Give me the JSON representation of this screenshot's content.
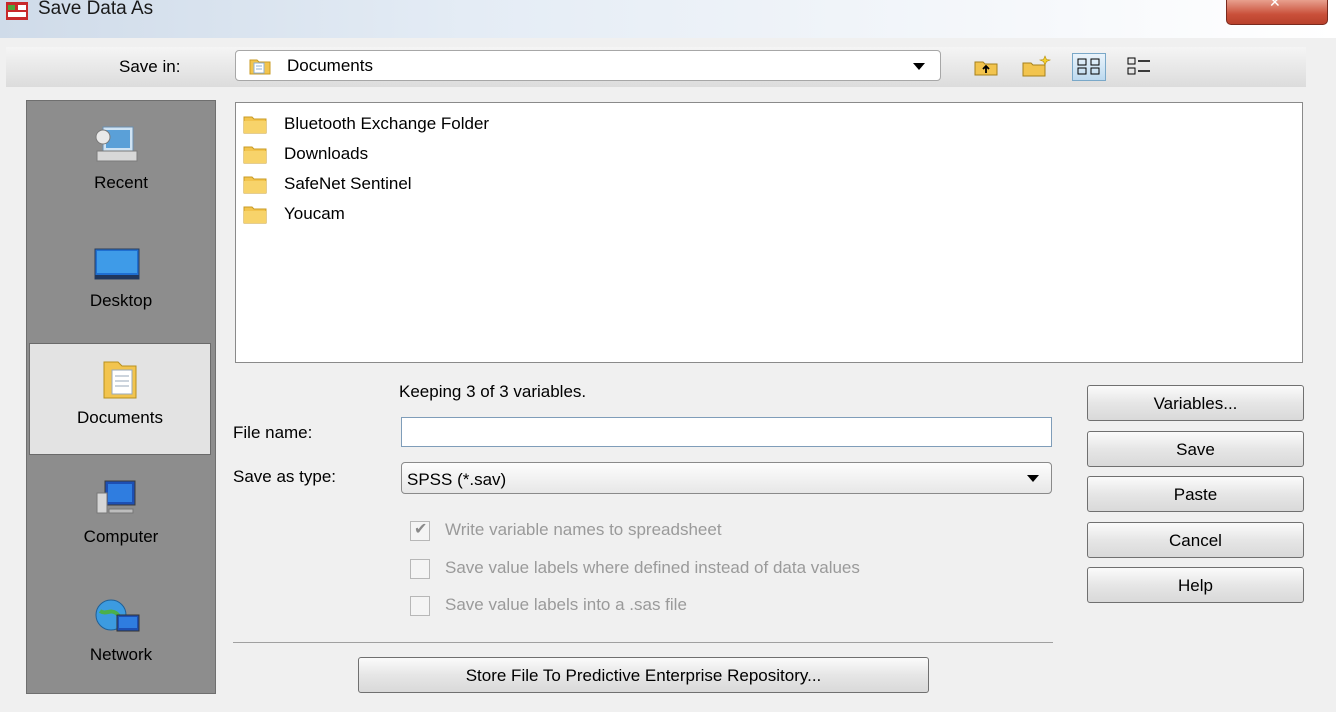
{
  "window": {
    "title": "Save Data As",
    "close_label": "✕"
  },
  "save_in": {
    "label": "Save in:",
    "location": "Documents"
  },
  "toolbar": {
    "up_icon": "up-folder-icon",
    "new_folder_icon": "new-folder-icon",
    "list_view_icon": "list-view-icon",
    "details_view_icon": "details-view-icon"
  },
  "places": [
    {
      "label": "Recent",
      "icon": "recent-icon"
    },
    {
      "label": "Desktop",
      "icon": "desktop-icon"
    },
    {
      "label": "Documents",
      "icon": "documents-icon",
      "selected": true
    },
    {
      "label": "Computer",
      "icon": "computer-icon"
    },
    {
      "label": "Network",
      "icon": "network-icon"
    }
  ],
  "files": [
    {
      "name": "Bluetooth Exchange Folder",
      "icon": "folder-icon"
    },
    {
      "name": "Downloads",
      "icon": "folder-icon"
    },
    {
      "name": "SafeNet Sentinel",
      "icon": "folder-icon"
    },
    {
      "name": "Youcam",
      "icon": "folder-icon"
    }
  ],
  "status": "Keeping 3 of 3 variables.",
  "form": {
    "file_name_label": "File name:",
    "file_name_value": "",
    "save_as_type_label": "Save as type:",
    "save_as_type_value": "SPSS (*.sav)"
  },
  "options": [
    {
      "label": "Write variable names to spreadsheet",
      "checked": true,
      "disabled": true
    },
    {
      "label": "Save value labels where defined instead of data values",
      "checked": false,
      "disabled": true
    },
    {
      "label": "Save value labels into a .sas file",
      "checked": false,
      "disabled": true
    }
  ],
  "buttons": {
    "variables": "Variables...",
    "save": "Save",
    "paste": "Paste",
    "cancel": "Cancel",
    "help": "Help",
    "store": "Store File To Predictive Enterprise Repository..."
  },
  "colors": {
    "places_bg": "#8d8d8d",
    "selected_place_bg": "#e3e3e3",
    "folder": "#f2c44e",
    "close": "#c9503a"
  }
}
